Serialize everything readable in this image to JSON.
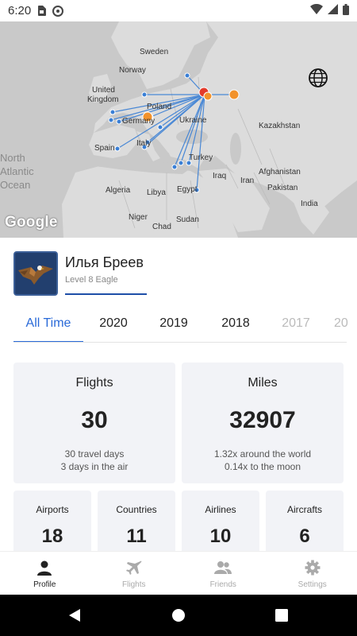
{
  "status_bar": {
    "time": "6:20"
  },
  "map": {
    "labels": {
      "sweden": "Sweden",
      "norway": "Norway",
      "united_kingdom_1": "United",
      "united_kingdom_2": "Kingdom",
      "poland": "Poland",
      "germany": "Germany",
      "ukraine": "Ukraine",
      "spain": "Spain",
      "italy": "Italy",
      "turkey": "Turkey",
      "kazakhstan": "Kazakhstan",
      "afghanistan": "Afghanistan",
      "pakistan": "Pakistan",
      "iraq": "Iraq",
      "iran": "Iran",
      "india": "India",
      "algeria": "Algeria",
      "libya": "Libya",
      "egypt": "Egypt",
      "niger": "Niger",
      "chad": "Chad",
      "sudan": "Sudan",
      "ocean_1": "North",
      "ocean_2": "Atlantic",
      "ocean_3": "Ocean"
    },
    "google": "Google",
    "colors": {
      "route": "#3a7fd5",
      "hub": "#e33b2b",
      "airport_orange": "#f2922b",
      "land": "#dcdcdc",
      "sea": "#c9c9c9"
    }
  },
  "profile": {
    "name": "Илья Бреев",
    "level": "Level 8 Eagle",
    "level_progress": 0.34
  },
  "year_tabs": [
    "All Time",
    "2020",
    "2019",
    "2018",
    "2017",
    "20"
  ],
  "stats": {
    "flights": {
      "title": "Flights",
      "value": "30",
      "sub1": "30 travel days",
      "sub2": "3 days in the air"
    },
    "miles": {
      "title": "Miles",
      "value": "32907",
      "sub1": "1.32x around the world",
      "sub2": "0.14x to the moon"
    },
    "airports": {
      "title": "Airports",
      "value": "18"
    },
    "countries": {
      "title": "Countries",
      "value": "11"
    },
    "airlines": {
      "title": "Airlines",
      "value": "10"
    },
    "aircrafts": {
      "title": "Aircrafts",
      "value": "6"
    }
  },
  "bottom_nav": {
    "profile": "Profile",
    "flights": "Flights",
    "friends": "Friends",
    "settings": "Settings"
  },
  "accent_color": "#2a6ad8"
}
